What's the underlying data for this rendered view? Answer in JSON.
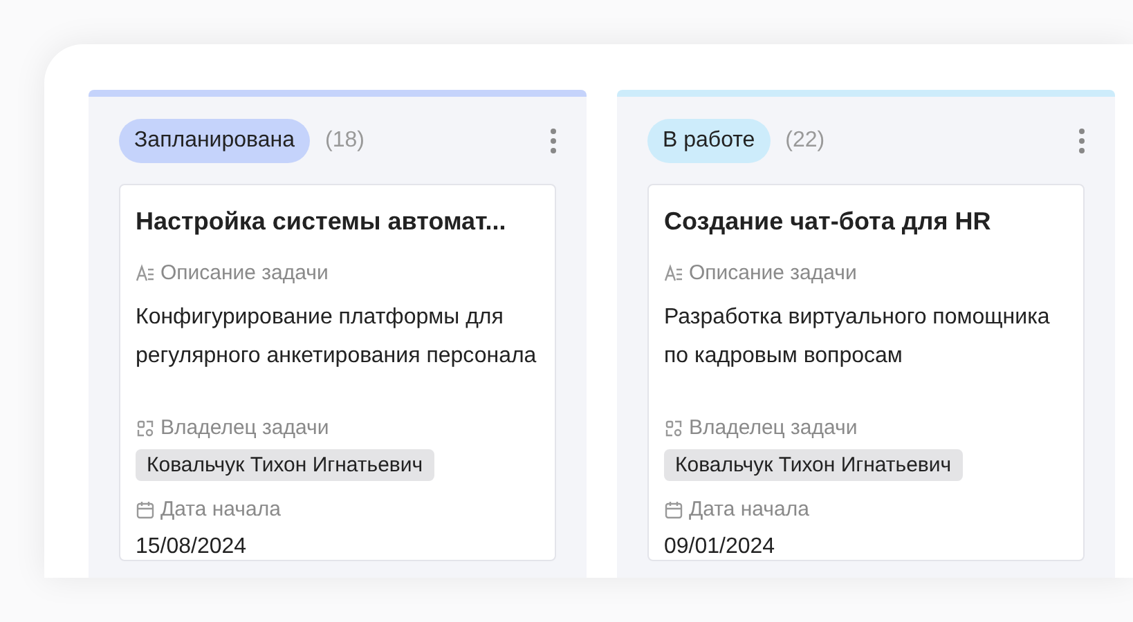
{
  "columns": [
    {
      "status": "Запланирована",
      "count": "(18)",
      "color": "#c5d3fb",
      "cards": [
        {
          "title": "Настройка системы автомат...",
          "description_label": "Описание задачи",
          "description": "Конфигурирование платформы для регулярного анкетирования персонала",
          "owner_label": "Владелец задачи",
          "owner": "Ковальчук Тихон Игнатьевич",
          "start_label": "Дата начала",
          "start": "15/08/2024"
        }
      ]
    },
    {
      "status": "В работе",
      "count": "(22)",
      "color": "#cdecfb",
      "cards": [
        {
          "title": "Создание чат-бота для HR",
          "description_label": "Описание задачи",
          "description": "Разработка виртуального помощника по кадровым вопросам",
          "owner_label": "Владелец задачи",
          "owner": "Ковальчук Тихон Игнатьевич",
          "start_label": "Дата начала",
          "start": "09/01/2024"
        }
      ]
    }
  ]
}
